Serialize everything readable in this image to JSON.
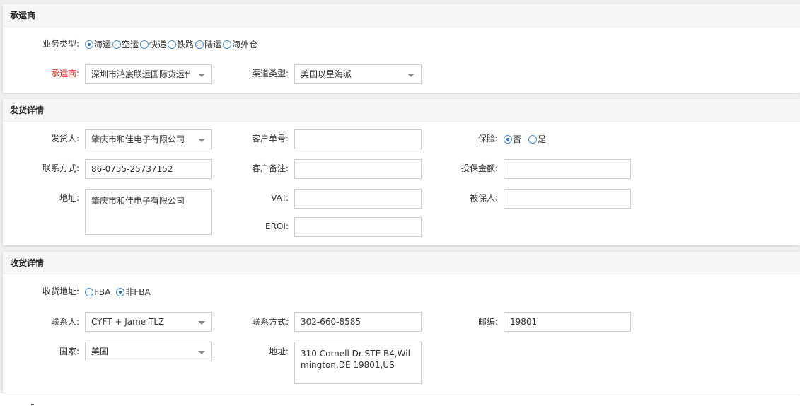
{
  "carrier": {
    "section_title": "承运商",
    "business_type_label": "业务类型:",
    "business_types": [
      {
        "label": "海运",
        "selected": true
      },
      {
        "label": "空运",
        "selected": false
      },
      {
        "label": "快递",
        "selected": false
      },
      {
        "label": "铁路",
        "selected": false
      },
      {
        "label": "陆运",
        "selected": false
      },
      {
        "label": "海外仓",
        "selected": false
      }
    ],
    "carrier_label": "承运商:",
    "carrier_value": "深圳市鸿宸联运国际货运代",
    "channel_label": "渠道类型:",
    "channel_value": "美国以星海派"
  },
  "shipper": {
    "section_title": "发货详情",
    "shipper_label": "发货人:",
    "shipper_value": "肇庆市和佳电子有限公司",
    "customer_no_label": "客户单号:",
    "customer_no_value": "",
    "insurance_label": "保险:",
    "insurance_options": [
      {
        "label": "否",
        "selected": true
      },
      {
        "label": "是",
        "selected": false
      }
    ],
    "contact_label": "联系方式:",
    "contact_value": "86-0755-25737152",
    "remark_label": "客户备注:",
    "remark_value": "",
    "insured_amount_label": "投保金额:",
    "insured_amount_value": "",
    "address_label": "地址:",
    "address_value": "肇庆市和佳电子有限公司",
    "vat_label": "VAT:",
    "vat_value": "",
    "insured_person_label": "被保人:",
    "insured_person_value": "",
    "eori_label": "EROI:",
    "eori_value": ""
  },
  "consignee": {
    "section_title": "收货详情",
    "address_type_label": "收货地址:",
    "address_types": [
      {
        "label": "FBA",
        "selected": false
      },
      {
        "label": "非FBA",
        "selected": true
      }
    ],
    "contact_person_label": "联系人:",
    "contact_person_value": "CYFT + Jame TLZ",
    "phone_label": "联系方式:",
    "phone_value": "302-660-8585",
    "zip_label": "邮编:",
    "zip_value": "19801",
    "country_label": "国家:",
    "country_value": "美国",
    "address_label": "地址:",
    "address_value": "310 Cornell Dr STE B4,Wilmington,DE 19801,US"
  },
  "colors": {
    "required_label": "#e0321e",
    "radio_accent": "#2b6cb0",
    "section_header_bg": "#f7f7f7",
    "page_bg": "#eeeeee"
  }
}
